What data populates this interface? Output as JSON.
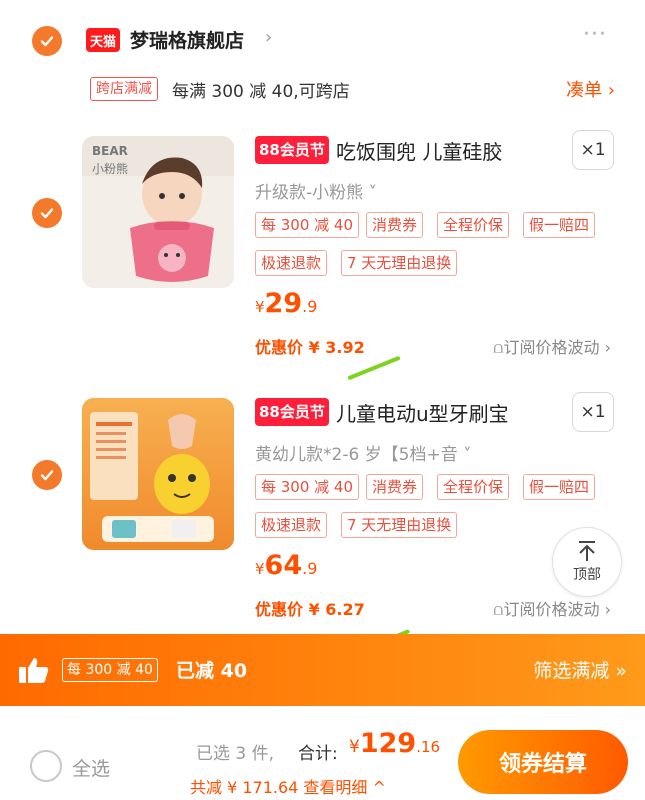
{
  "store": {
    "logo_text": "天猫",
    "name": "梦瑞格旗舰店",
    "arrow": "›",
    "more": "···"
  },
  "promo": {
    "tag": "跨店满减",
    "text": "每满 300 减 40,可跨店",
    "coudan": "凑单 ›"
  },
  "items": [
    {
      "badge": "88会员节",
      "title": "吃饭围兜 儿童硅胶",
      "qty": "×1",
      "sku": "升级款-小粉熊 ˅",
      "thumb_brand": "BEAR",
      "thumb_sub": "小粉熊",
      "tags": [
        "每 300 减 40",
        "消费券",
        "全程价保",
        "假一赔四",
        "极速退款",
        "7 天无理由退换"
      ],
      "price_cur": "¥",
      "price_int": "29",
      "price_dec": ".9",
      "discount": "优惠价 ¥ 3.92",
      "subscribe": "订阅价格波动 ›"
    },
    {
      "badge": "88会员节",
      "title": "儿童电动u型牙刷宝",
      "qty": "×1",
      "sku": "黄幼儿款*2-6 岁【5档+音  ˅",
      "tags": [
        "每 300 减 40",
        "消费券",
        "全程价保",
        "假一赔四",
        "极速退款",
        "7 天无理由退换"
      ],
      "price_cur": "¥",
      "price_int": "64",
      "price_dec": ".9",
      "discount": "优惠价 ¥ 6.27",
      "subscribe": "订阅价格波动 ›"
    }
  ],
  "top_button": "顶部",
  "bar": {
    "tag": "每 300 减 40",
    "text": "已减 40",
    "filter": "筛选满减 »"
  },
  "footer": {
    "select_all": "全选",
    "selected": "已选 3 件,",
    "total_label": "合计:",
    "total_cur": "¥",
    "total_int": "129",
    "total_dec": ".16",
    "saved": "共减 ¥ 171.64  查看明细 ^",
    "checkout": "领券结算"
  },
  "colors": {
    "accent": "#ff5000",
    "check": "#f5792a",
    "badge": "#ff1f3a"
  }
}
